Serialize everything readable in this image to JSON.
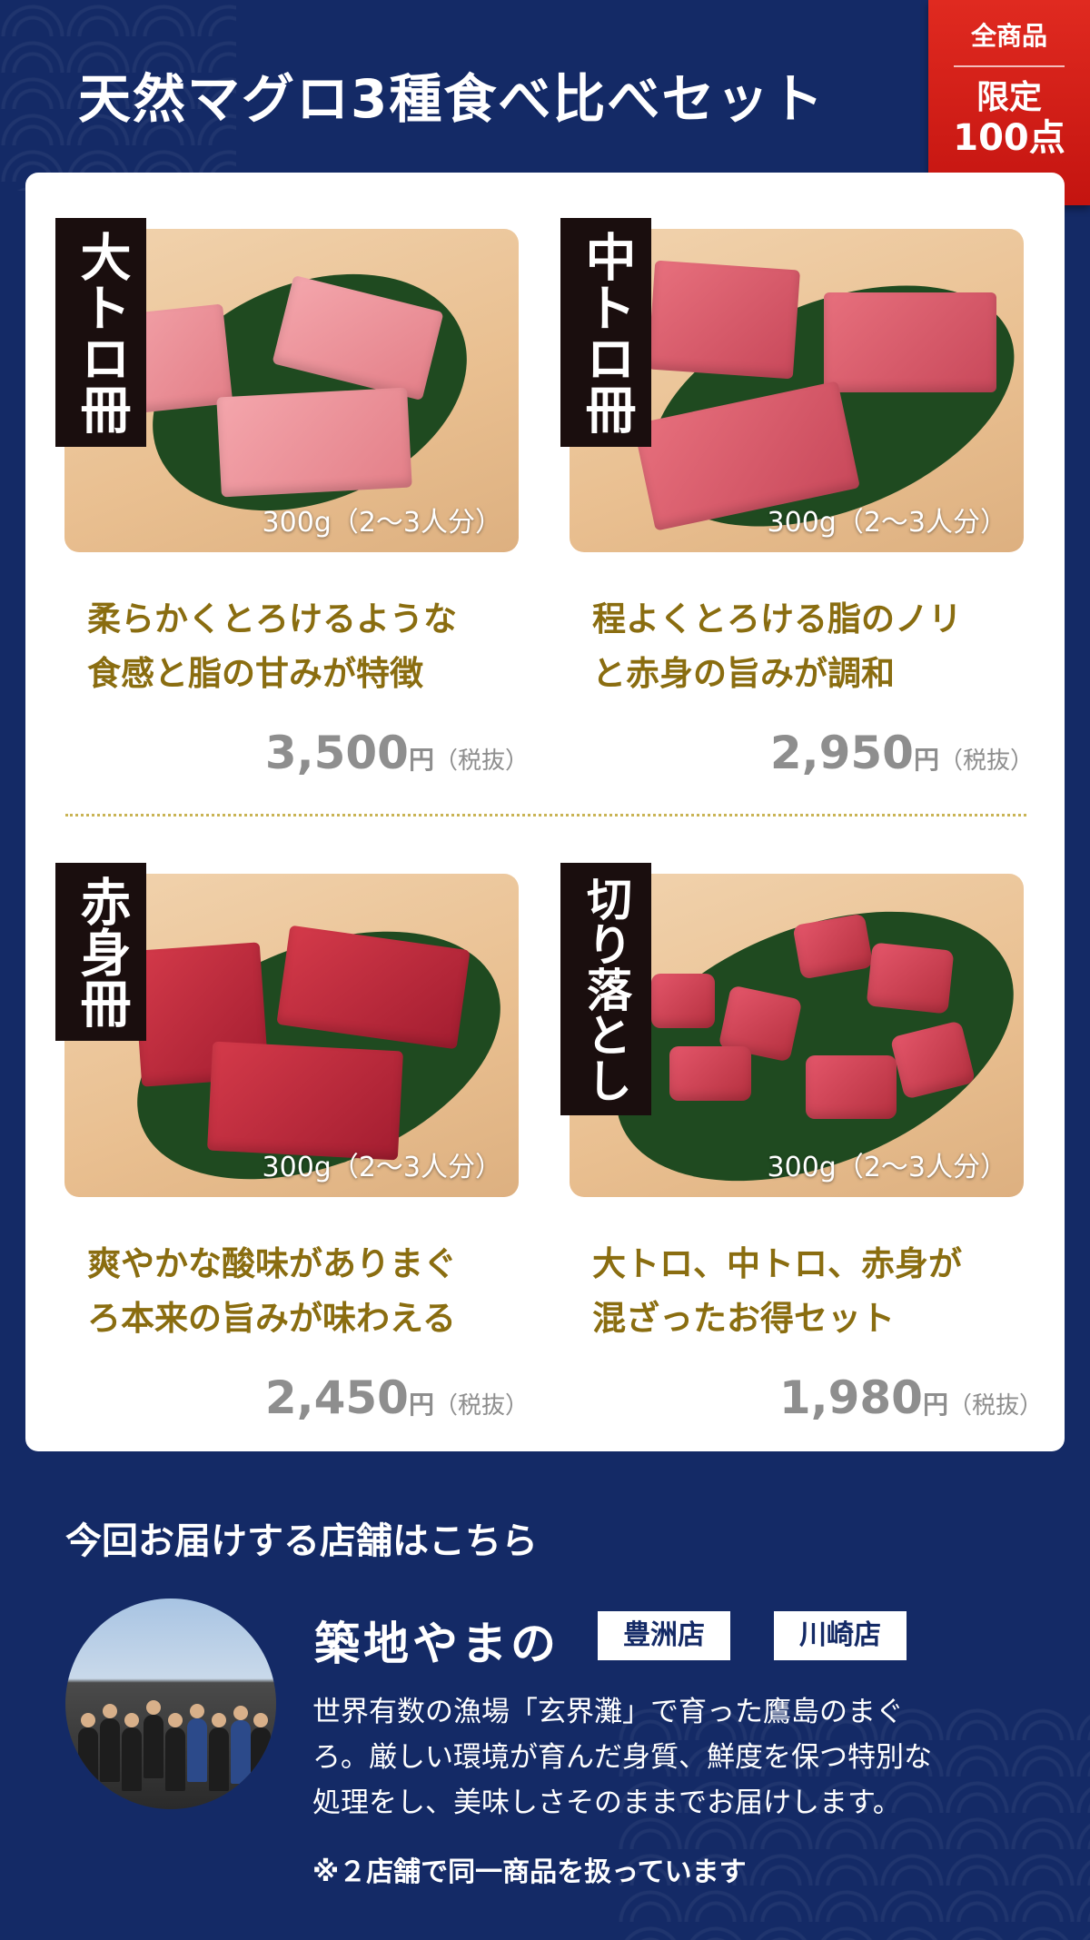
{
  "header": {
    "title": "天然マグロ3種食べ比べセット",
    "badge_top": "全商品",
    "badge_mid": "限定",
    "badge_bottom": "100点"
  },
  "products": [
    {
      "label": "大トロ冊",
      "weight": "300g（2〜3人分）",
      "desc_line1": "柔らかくとろけるような",
      "desc_line2": "食感と脂の甘みが特徴",
      "price": "3,500",
      "yen": "円",
      "tax": "（税抜）"
    },
    {
      "label": "中トロ冊",
      "weight": "300g（2〜3人分）",
      "desc_line1": "程よくとろける脂のノリ",
      "desc_line2": "と赤身の旨みが調和",
      "price": "2,950",
      "yen": "円",
      "tax": "（税抜）"
    },
    {
      "label": "赤身冊",
      "weight": "300g（2〜3人分）",
      "desc_line1": "爽やかな酸味がありまぐ",
      "desc_line2": "ろ本来の旨みが味わえる",
      "price": "2,450",
      "yen": "円",
      "tax": "（税抜）"
    },
    {
      "label": "切り落とし",
      "weight": "300g（2〜3人分）",
      "desc_line1": "大トロ、中トロ、赤身が",
      "desc_line2": "混ざったお得セット",
      "price": "1,980",
      "yen": "円",
      "tax": "（税抜）"
    }
  ],
  "store": {
    "heading": "今回お届けする店舗はこちら",
    "name": "築地やまの",
    "branches": [
      "豊洲店",
      "川崎店"
    ],
    "desc_line1": "世界有数の漁場「玄界灘」で育った鷹島のまぐ",
    "desc_line2": "ろ。厳しい環境が育んだ身質、鮮度を保つ特別な",
    "desc_line3": "処理をし、美味しさそのままでお届けします。",
    "note": "※２店舗で同一商品を扱っています"
  },
  "colors": {
    "background": "#142a66",
    "badge": "#c41410",
    "description": "#8a6d10",
    "price": "#8e8e8e"
  }
}
